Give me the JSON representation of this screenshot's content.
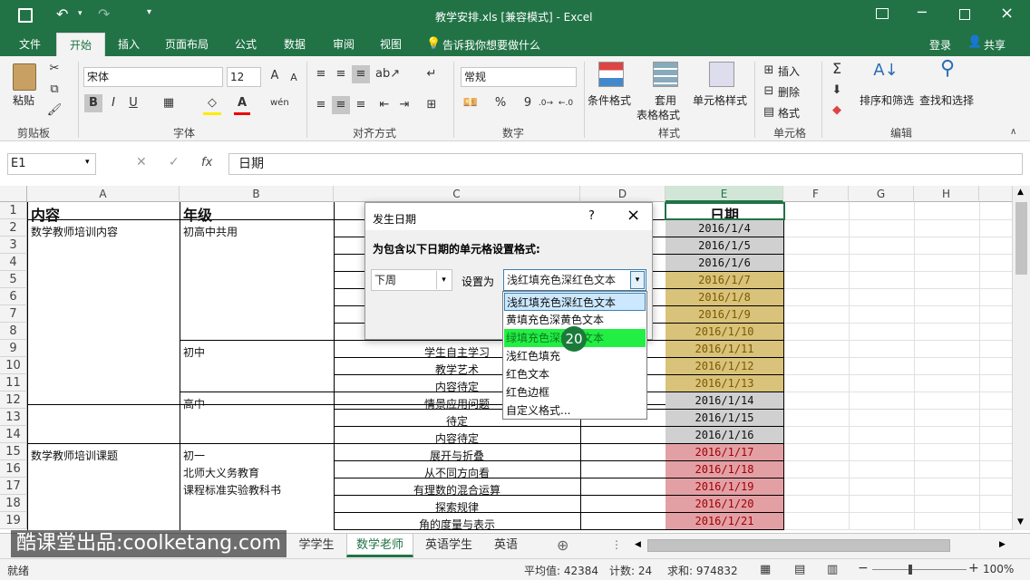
{
  "titlebar": {
    "title": "教学安排.xls  [兼容模式] - Excel",
    "save_icon": "save-icon",
    "undo_icon": "undo-icon",
    "redo_icon": "redo-icon"
  },
  "menu": {
    "items": [
      "文件",
      "开始",
      "插入",
      "页面布局",
      "公式",
      "数据",
      "审阅",
      "视图"
    ],
    "tell_me": "告诉我你想要做什么",
    "login": "登录",
    "share": "共享"
  },
  "ribbon": {
    "clipboard": {
      "paste": "粘贴",
      "label": "剪贴板"
    },
    "font": {
      "name": "宋体",
      "size": "12",
      "label": "字体",
      "bold": "B",
      "italic": "I",
      "underline": "U"
    },
    "align": {
      "label": "对齐方式"
    },
    "number": {
      "format": "常规",
      "label": "数字",
      "percent": "%",
      "comma": "9"
    },
    "styles": {
      "cond": "条件格式",
      "table_1": "套用",
      "table_2": "表格格式",
      "cell": "单元格样式",
      "label": "样式"
    },
    "cells": {
      "insert": "插入",
      "delete": "删除",
      "format": "格式",
      "label": "单元格"
    },
    "editing": {
      "sort": "排序和筛选",
      "find": "查找和选择",
      "label": "编辑"
    }
  },
  "formula": {
    "namebox": "E1",
    "fx": "fx",
    "value": "日期"
  },
  "columns": [
    "A",
    "B",
    "C",
    "D",
    "E",
    "F",
    "G",
    "H"
  ],
  "rows": [
    "1",
    "2",
    "3",
    "4",
    "5",
    "6",
    "7",
    "8",
    "9",
    "10",
    "11",
    "12",
    "13",
    "14",
    "15",
    "16",
    "17",
    "18",
    "19"
  ],
  "cells": {
    "A1": "内容",
    "B1": "年级",
    "E1": "日期",
    "A2": "数学教师培训内容",
    "B2": "初高中共用",
    "B9": "初中",
    "B12": "高中",
    "A15": "数学教师培训课题",
    "B15": "初一",
    "B16": "北师大义务教育",
    "B17": "课程标准实验教科书",
    "C9": "学生自主学习",
    "C10": "教学艺术",
    "C11": "内容待定",
    "C12": "情景应用问题",
    "C13": "待定",
    "C14": "内容待定",
    "C15": "展开与折叠",
    "C16": "从不同方向看",
    "C17": "有理数的混合运算",
    "C18": "探索规律",
    "C19": "角的度量与表示"
  },
  "dates": [
    "2016/1/4",
    "2016/1/5",
    "2016/1/6",
    "2016/1/7",
    "2016/1/8",
    "2016/1/9",
    "2016/1/10",
    "2016/1/11",
    "2016/1/12",
    "2016/1/13",
    "2016/1/14",
    "2016/1/15",
    "2016/1/16",
    "2016/1/17",
    "2016/1/18",
    "2016/1/19",
    "2016/1/20",
    "2016/1/21"
  ],
  "dialog": {
    "title": "发生日期",
    "help": "?",
    "close": "×",
    "prompt": "为包含以下日期的单元格设置格式:",
    "period": "下周",
    "set_as": "设置为",
    "format": "浅红填充色深红色文本"
  },
  "dropdown": {
    "items": [
      "浅红填充色深红色文本",
      "黄填充色深黄色文本",
      "绿填充色深绿色文本",
      "浅红色填充",
      "红色文本",
      "红色边框",
      "自定义格式..."
    ],
    "badge": "20"
  },
  "sheets": {
    "partial": "学学生",
    "items": [
      "数学老师",
      "英语学生",
      "英语"
    ]
  },
  "status": {
    "ready": "就绪",
    "avg": "平均值: 42384",
    "count": "计数: 24",
    "sum": "求和: 974832",
    "zoom": "100%"
  },
  "watermark": "酷课堂出品:coolketang.com",
  "colors": {
    "green": "#217346",
    "gray_fill": "#d0d0d0",
    "yellow_fill": "#d9c27a",
    "red_fill": "#e3a0a4",
    "select": "#cce8ff",
    "highlight": "#22ee44"
  }
}
